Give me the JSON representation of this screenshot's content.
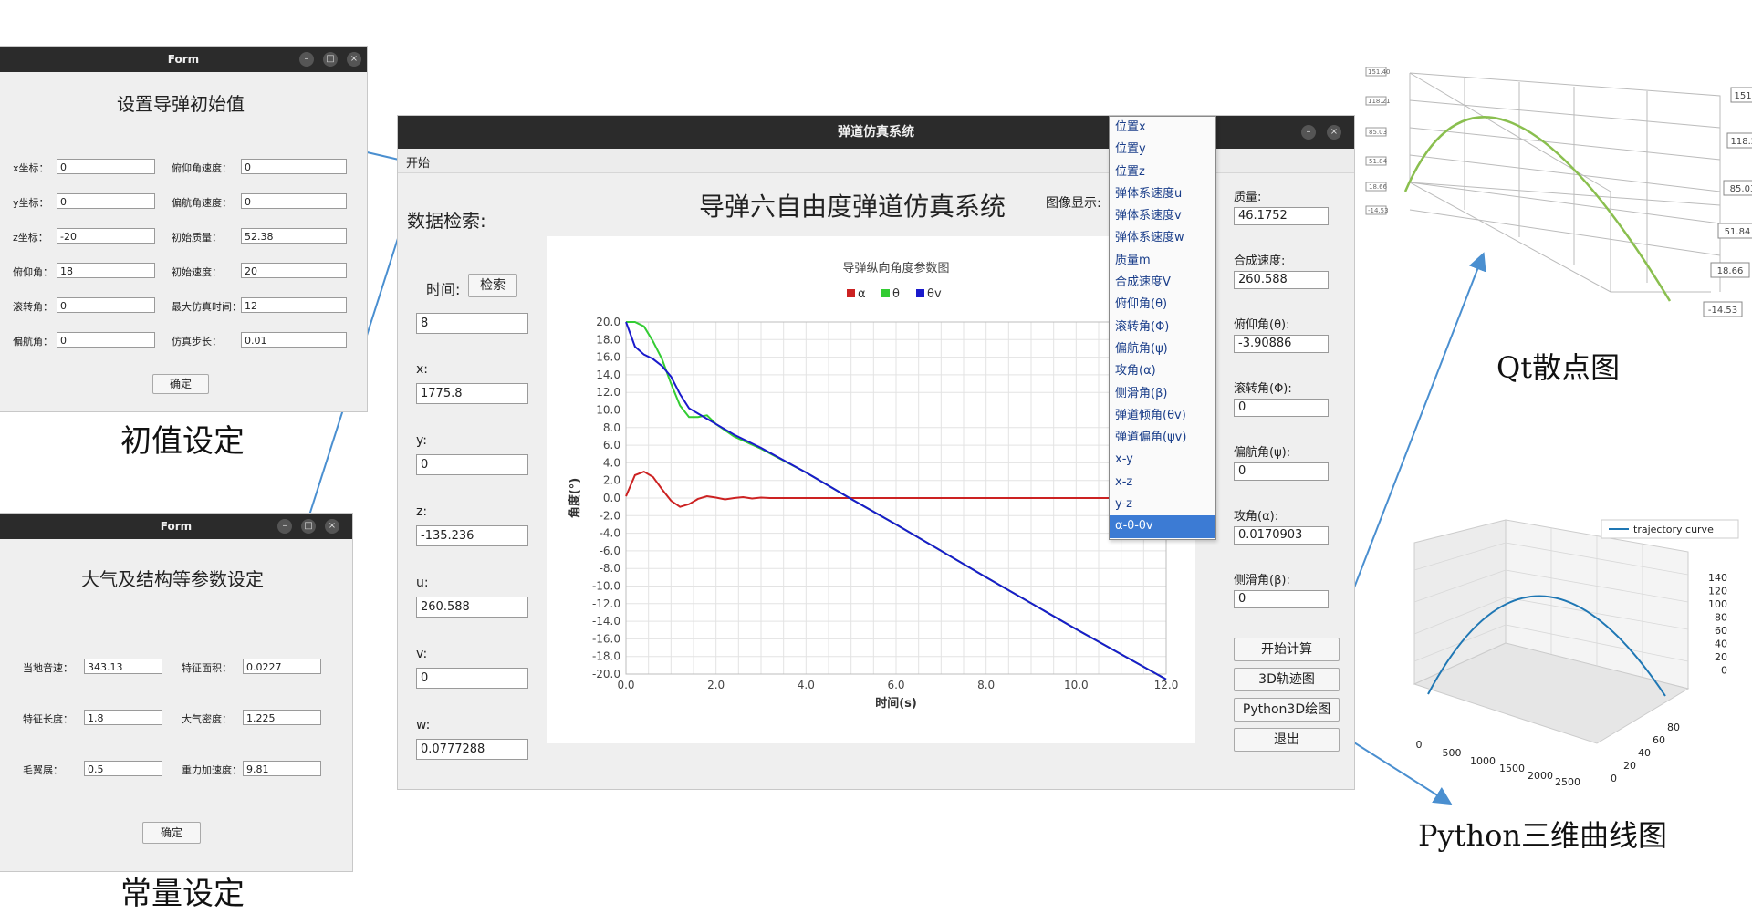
{
  "init_window": {
    "title": "Form",
    "heading": "设置导弹初始值",
    "rows": [
      {
        "l_label": "x坐标：",
        "l_value": "0",
        "r_label": "俯仰角速度：",
        "r_value": "0"
      },
      {
        "l_label": "y坐标：",
        "l_value": "0",
        "r_label": "偏航角速度：",
        "r_value": "0"
      },
      {
        "l_label": "z坐标：",
        "l_value": "-20",
        "r_label": "初始质量：",
        "r_value": "52.38"
      },
      {
        "l_label": "俯仰角：",
        "l_value": "18",
        "r_label": "初始速度：",
        "r_value": "20"
      },
      {
        "l_label": "滚转角：",
        "l_value": "0",
        "r_label": "最大仿真时间：",
        "r_value": "12"
      },
      {
        "l_label": "偏航角：",
        "l_value": "0",
        "r_label": "仿真步长：",
        "r_value": "0.01"
      }
    ],
    "ok_label": "确定",
    "caption": "初值设定"
  },
  "const_window": {
    "title": "Form",
    "heading": "大气及结构等参数设定",
    "rows": [
      {
        "l_label": "当地音速：",
        "l_value": "343.13",
        "r_label": "特征面积：",
        "r_value": "0.0227"
      },
      {
        "l_label": "特征长度：",
        "l_value": "1.8",
        "r_label": "大气密度：",
        "r_value": "1.225"
      },
      {
        "l_label": "毛翼展：",
        "l_value": "0.5",
        "r_label": "重力加速度：",
        "r_value": "9.81"
      }
    ],
    "ok_label": "确定",
    "caption": "常量设定"
  },
  "main_window": {
    "title": "弹道仿真系统",
    "menu_start": "开始",
    "app_title": "导弹六自由度弹道仿真系统",
    "image_display_label": "图像显示:",
    "search_heading": "数据检索:",
    "time_label": "时间:",
    "search_button": "检索",
    "time_value": "8",
    "left_fields": [
      {
        "label": "x:",
        "value": "1775.8"
      },
      {
        "label": "y:",
        "value": "0"
      },
      {
        "label": "z:",
        "value": "-135.236"
      },
      {
        "label": "u:",
        "value": "260.588"
      },
      {
        "label": "v:",
        "value": "0"
      },
      {
        "label": "w:",
        "value": "0.0777288"
      }
    ],
    "right_fields": [
      {
        "label": "质量:",
        "value": "46.1752"
      },
      {
        "label": "合成速度:",
        "value": "260.588"
      },
      {
        "label": "俯仰角(θ):",
        "value": "-3.90886"
      },
      {
        "label": "滚转角(Φ):",
        "value": "0"
      },
      {
        "label": "偏航角(ψ):",
        "value": "0"
      },
      {
        "label": "攻角(α):",
        "value": "0.0170903"
      },
      {
        "label": "侧滑角(β):",
        "value": "0"
      }
    ],
    "buttons": {
      "calc": "开始计算",
      "traj3d": "3D轨迹图",
      "py3d": "Python3D绘图",
      "exit": "退出"
    },
    "dropdown_items": [
      "位置x",
      "位置y",
      "位置z",
      "弹体系速度u",
      "弹体系速度v",
      "弹体系速度w",
      "质量m",
      "合成速度V",
      "俯仰角(θ)",
      "滚转角(Φ)",
      "偏航角(ψ)",
      "攻角(α)",
      "侧滑角(β)",
      "弹道倾角(θv)",
      "弹道偏角(ψv)",
      "x-y",
      "x-z",
      "y-z",
      "α-θ-θv"
    ],
    "dropdown_selected": "α-θ-θv"
  },
  "chart_data": {
    "type": "line",
    "title": "导弹纵向角度参数图",
    "xlabel": "时间(s)",
    "ylabel": "角度(°)",
    "xlim": [
      0,
      12
    ],
    "ylim": [
      -20,
      20
    ],
    "x_ticks": [
      "0.0",
      "2.0",
      "4.0",
      "6.0",
      "8.0",
      "10.0",
      "12.0"
    ],
    "y_ticks": [
      "20.0",
      "18.0",
      "16.0",
      "14.0",
      "12.0",
      "10.0",
      "8.0",
      "6.0",
      "4.0",
      "2.0",
      "0.0",
      "-2.0",
      "-4.0",
      "-6.0",
      "-8.0",
      "-10.0",
      "-12.0",
      "-14.0",
      "-16.0",
      "-18.0",
      "-20.0"
    ],
    "grid": true,
    "legend": "top-center",
    "series": [
      {
        "name": "α",
        "color": "#cc2222",
        "x": [
          0,
          0.2,
          0.4,
          0.6,
          0.8,
          1.0,
          1.2,
          1.4,
          1.6,
          1.8,
          2.0,
          2.2,
          2.4,
          2.6,
          2.8,
          3.0,
          3.2,
          12
        ],
        "y": [
          0.2,
          2.6,
          3.0,
          2.4,
          1.0,
          -0.3,
          -1.0,
          -0.7,
          -0.1,
          0.2,
          0.05,
          -0.15,
          0.0,
          0.1,
          -0.05,
          0.05,
          0,
          0
        ]
      },
      {
        "name": "θ",
        "color": "#33cc33",
        "x": [
          0,
          0.2,
          0.4,
          0.6,
          0.8,
          1.0,
          1.2,
          1.4,
          1.6,
          1.8,
          2.0,
          2.4,
          3.0,
          4.0,
          5.0,
          6.0,
          8.0,
          10.0,
          12.0
        ],
        "y": [
          20,
          20,
          19.5,
          17.8,
          15.8,
          13.0,
          10.5,
          9.2,
          9.2,
          9.4,
          8.4,
          7.0,
          5.6,
          2.9,
          -0.1,
          -3.0,
          -9.0,
          -14.9,
          -20.6
        ]
      },
      {
        "name": "θv",
        "color": "#1a1acc",
        "x": [
          0,
          0.2,
          0.4,
          0.6,
          0.8,
          1.0,
          1.2,
          1.4,
          1.6,
          1.8,
          2.0,
          2.4,
          3.0,
          4.0,
          5.0,
          6.0,
          8.0,
          10.0,
          12.0
        ],
        "y": [
          20,
          17.2,
          16.3,
          15.8,
          15.0,
          13.8,
          11.8,
          10.2,
          9.6,
          9.0,
          8.4,
          7.2,
          5.7,
          2.9,
          -0.1,
          -3.0,
          -9.0,
          -14.9,
          -20.6
        ]
      }
    ]
  },
  "qt_scatter": {
    "caption": "Qt散点图",
    "right_ticks": [
      "151.40",
      "118.21",
      "85.03",
      "51.84",
      "18.66",
      "-14.53"
    ]
  },
  "py_plot": {
    "caption": "Python三维曲线图",
    "legend": "trajectory curve",
    "z_ticks": [
      "140",
      "120",
      "100",
      "80",
      "60",
      "40",
      "20",
      "0"
    ],
    "x_ticks": [
      "0",
      "500",
      "1000",
      "1500",
      "2000",
      "2500"
    ],
    "y_ticks": [
      "0",
      "20",
      "40",
      "60",
      "80"
    ]
  }
}
